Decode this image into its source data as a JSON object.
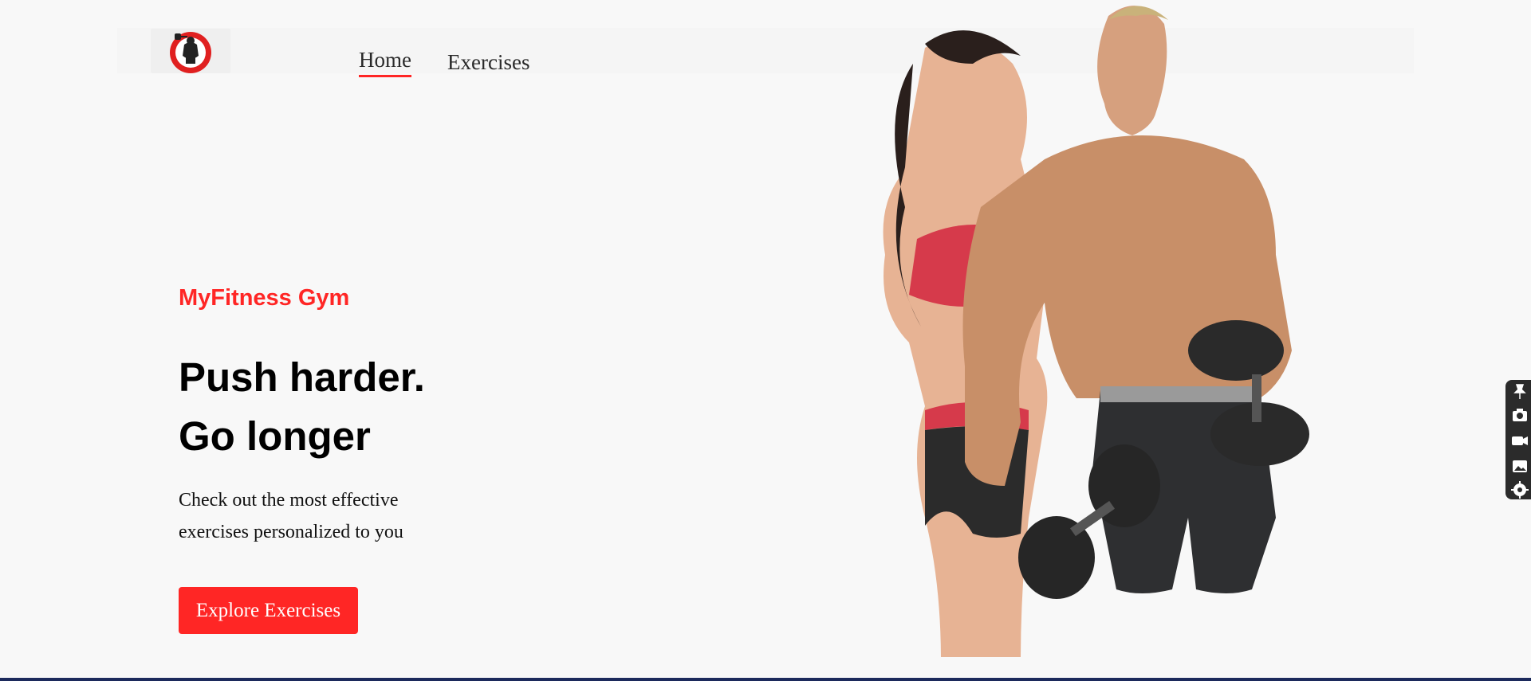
{
  "nav": {
    "logo_name": "dumbbell-logo",
    "links": [
      {
        "label": "Home",
        "active": true
      },
      {
        "label": "Exercises",
        "active": false
      }
    ]
  },
  "hero": {
    "subtitle": "MyFitness Gym",
    "title_line1": "Push harder.",
    "title_line2": "Go longer",
    "description": "Check out the most effective exercises personalized to you",
    "cta_label": "Explore Exercises",
    "image": "fitness-couple-with-dumbbells"
  },
  "toolbar": {
    "icons": [
      "pin-icon",
      "camera-icon",
      "video-icon",
      "gallery-icon",
      "gear-icon"
    ]
  },
  "colors": {
    "accent": "#ff2625",
    "background": "#f8f8f8",
    "text": "#000000"
  }
}
